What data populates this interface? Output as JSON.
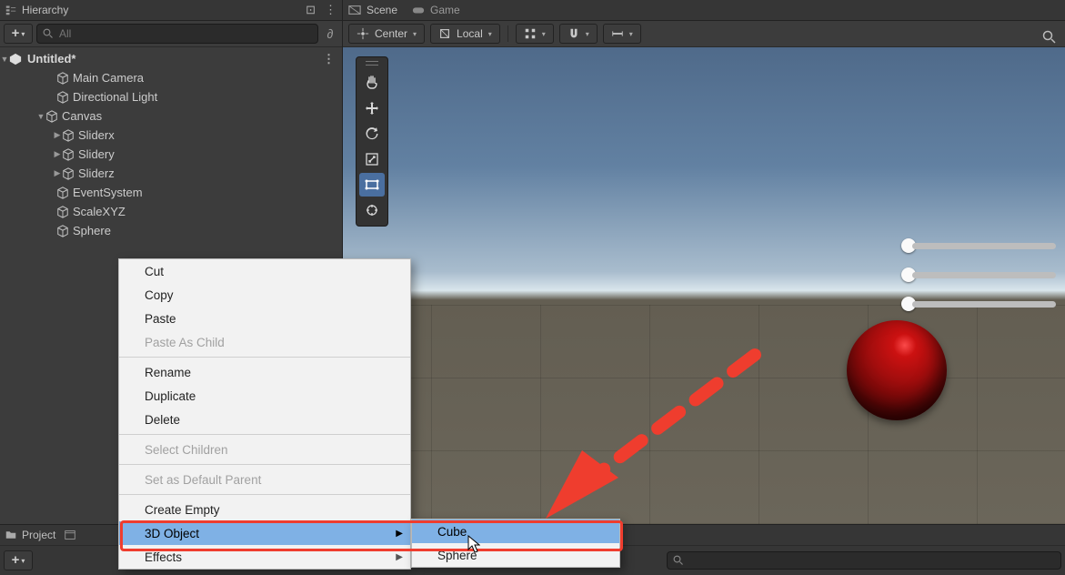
{
  "hierarchy": {
    "title": "Hierarchy",
    "search_placeholder": "All",
    "scene": "Untitled*",
    "items": [
      {
        "name": "Main Camera",
        "depth": 1
      },
      {
        "name": "Directional Light",
        "depth": 1
      },
      {
        "name": "Canvas",
        "depth": 1,
        "expanded": true
      },
      {
        "name": "Sliderx",
        "depth": 2,
        "haschild": true
      },
      {
        "name": "Slidery",
        "depth": 2,
        "haschild": true
      },
      {
        "name": "Sliderz",
        "depth": 2,
        "haschild": true
      },
      {
        "name": "EventSystem",
        "depth": 1
      },
      {
        "name": "ScaleXYZ",
        "depth": 1
      },
      {
        "name": "Sphere",
        "depth": 1
      }
    ]
  },
  "scene": {
    "tab1": "Scene",
    "tab2": "Game",
    "pivot": "Center",
    "space": "Local"
  },
  "context_menu": {
    "items": [
      {
        "label": "Cut"
      },
      {
        "label": "Copy"
      },
      {
        "label": "Paste"
      },
      {
        "label": "Paste As Child",
        "disabled": true
      },
      {
        "sep": true
      },
      {
        "label": "Rename"
      },
      {
        "label": "Duplicate"
      },
      {
        "label": "Delete"
      },
      {
        "sep": true
      },
      {
        "label": "Select Children",
        "disabled": true
      },
      {
        "sep": true
      },
      {
        "label": "Set as Default Parent",
        "disabled": true
      },
      {
        "sep": true
      },
      {
        "label": "Create Empty"
      },
      {
        "label": "3D Object",
        "submenu": true,
        "highlight": true
      },
      {
        "label": "Effects",
        "submenu": true
      }
    ],
    "submenu": [
      {
        "label": "Cube",
        "highlight": true
      },
      {
        "label": "Sphere"
      }
    ]
  },
  "project": {
    "tab": "Project"
  }
}
